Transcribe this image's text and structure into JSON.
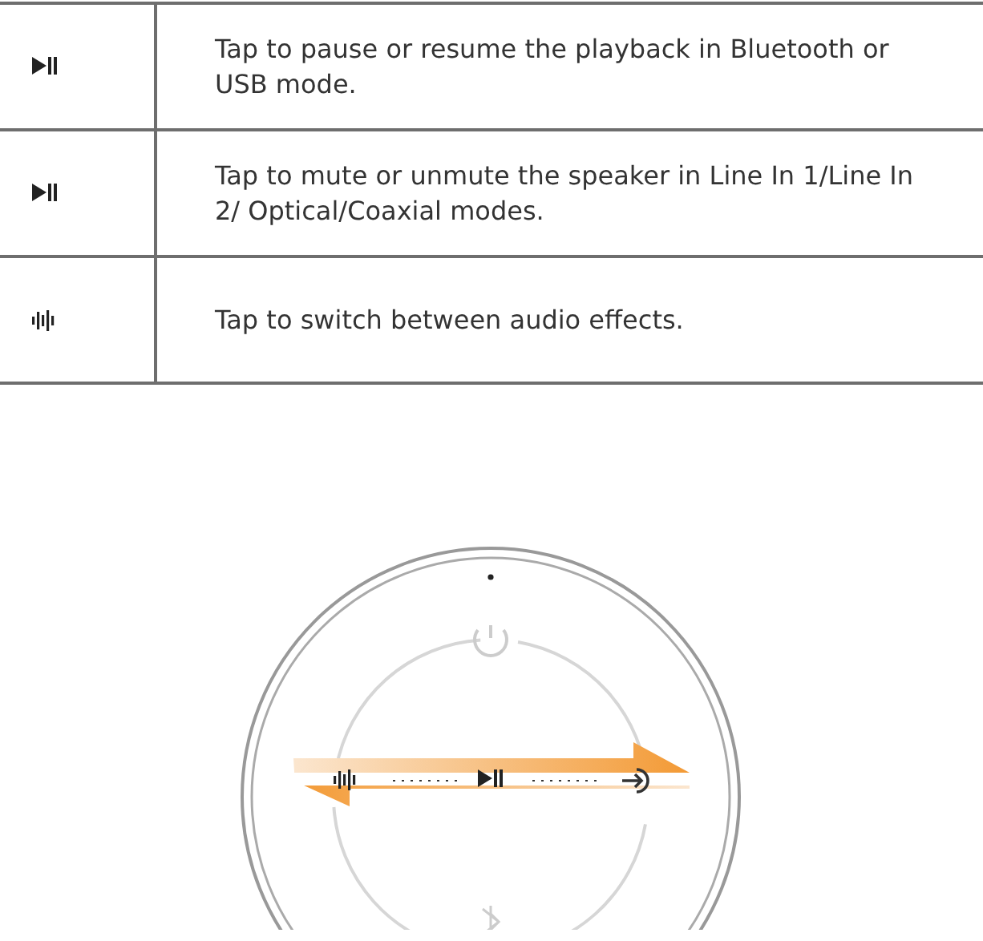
{
  "table": {
    "rows": [
      {
        "kind": "play-pause",
        "text": "Tap to pause or resume the playback in Bluetooth or USB mode."
      },
      {
        "kind": "play-pause",
        "text": "Tap to mute or unmute the speaker in Line In 1/Line In 2/ Optical/Coaxial modes."
      },
      {
        "kind": "waveform",
        "text": "Tap to switch between audio effects."
      }
    ]
  }
}
